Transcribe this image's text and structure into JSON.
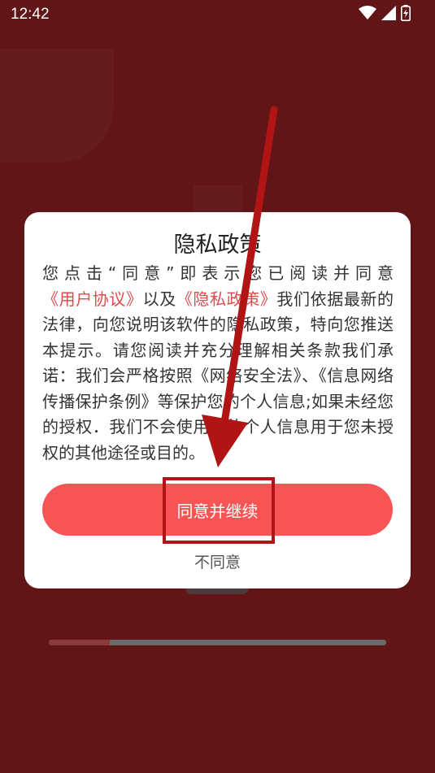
{
  "status_bar": {
    "time": "12:42",
    "icons": [
      "wifi-icon",
      "cellular-signal-icon",
      "battery-charging-icon"
    ]
  },
  "dialog": {
    "title": "隐私政策",
    "body": {
      "intro": "您点击“同意”即表示您已阅读并同意",
      "user_agreement_link": "《用户协议》",
      "and": "以及",
      "privacy_policy_link": "《隐私政策》",
      "rest": "我们依据最新的法律，向您说明该软件的隐私政策，特向您推送本提示。请您阅读并充分理解相关条款我们承诺：我们会严格按照《网络安全法》、《信息网络传播保护条例》等保护您的个人信息;如果未经您的授权．我们不会使用您的个人信息用于您未授权的其他途径或目的。"
    },
    "agree_label": "同意并继续",
    "disagree_label": "不同意"
  },
  "colors": {
    "backdrop": "#611517",
    "accent": "#f75455",
    "link": "#e04a4a",
    "annotation": "#b01414"
  },
  "onboarding_progress": 0.18
}
